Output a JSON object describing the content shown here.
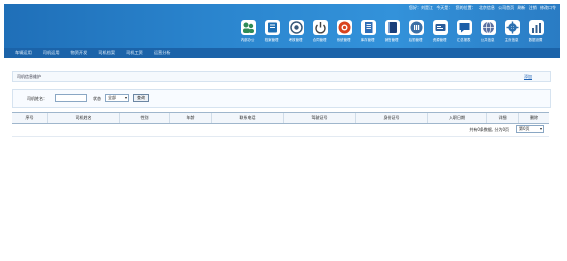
{
  "header": {
    "top_links": [
      "您好：刘是江",
      "今天是：",
      "您的位置：",
      "北京信息",
      "公司首页",
      "刷新",
      "注销",
      "修改口令"
    ],
    "modules": [
      {
        "label": "内部办公",
        "icon": "people-icon",
        "color": "#2e8b57"
      },
      {
        "label": "档案管理",
        "icon": "book-icon",
        "color": "#1e6fb3"
      },
      {
        "label": "考核管理",
        "icon": "target-icon",
        "color": "#3a5a7a"
      },
      {
        "label": "合同管理",
        "icon": "power-icon",
        "color": "#444444"
      },
      {
        "label": "系统管理",
        "icon": "red-circle-icon",
        "color": "#d9431f"
      },
      {
        "label": "库存管理",
        "icon": "document-icon",
        "color": "#2f6db5"
      },
      {
        "label": "销售管理",
        "icon": "ledger-icon",
        "color": "#1a3f7a"
      },
      {
        "label": "后勤管理",
        "icon": "building-icon",
        "color": "#3c6fa5"
      },
      {
        "label": "资源管理",
        "icon": "card-icon",
        "color": "#2a5c9a"
      },
      {
        "label": "汇总报表",
        "icon": "chat-icon",
        "color": "#1d5fa8"
      },
      {
        "label": "公共信息",
        "icon": "globe-icon",
        "color": "#5a6fa0"
      },
      {
        "label": "主页信息",
        "icon": "gear-icon",
        "color": "#2c70b0"
      },
      {
        "label": "数据设置",
        "icon": "chart-icon",
        "color": "#35608f"
      }
    ]
  },
  "nav": {
    "items": [
      "车辆运用",
      "司机运用",
      "物资开发",
      "司机档案",
      "司机工资",
      "运营分析"
    ]
  },
  "breadcrumb": {
    "text": "司机信息维护",
    "add_label": "添加"
  },
  "search": {
    "name_label": "司机姓名：",
    "name_value": "",
    "status_label": "状态",
    "status_value": "全部",
    "query_label": "查询"
  },
  "table": {
    "columns": [
      "序号",
      "司机姓名",
      "性别",
      "年龄",
      "联系电话",
      "驾驶证号",
      "身份证号",
      "入职日期",
      "详细",
      "删除"
    ]
  },
  "pagination": {
    "info": "共有0条数据, 分为0页",
    "page_value": "第0页"
  }
}
